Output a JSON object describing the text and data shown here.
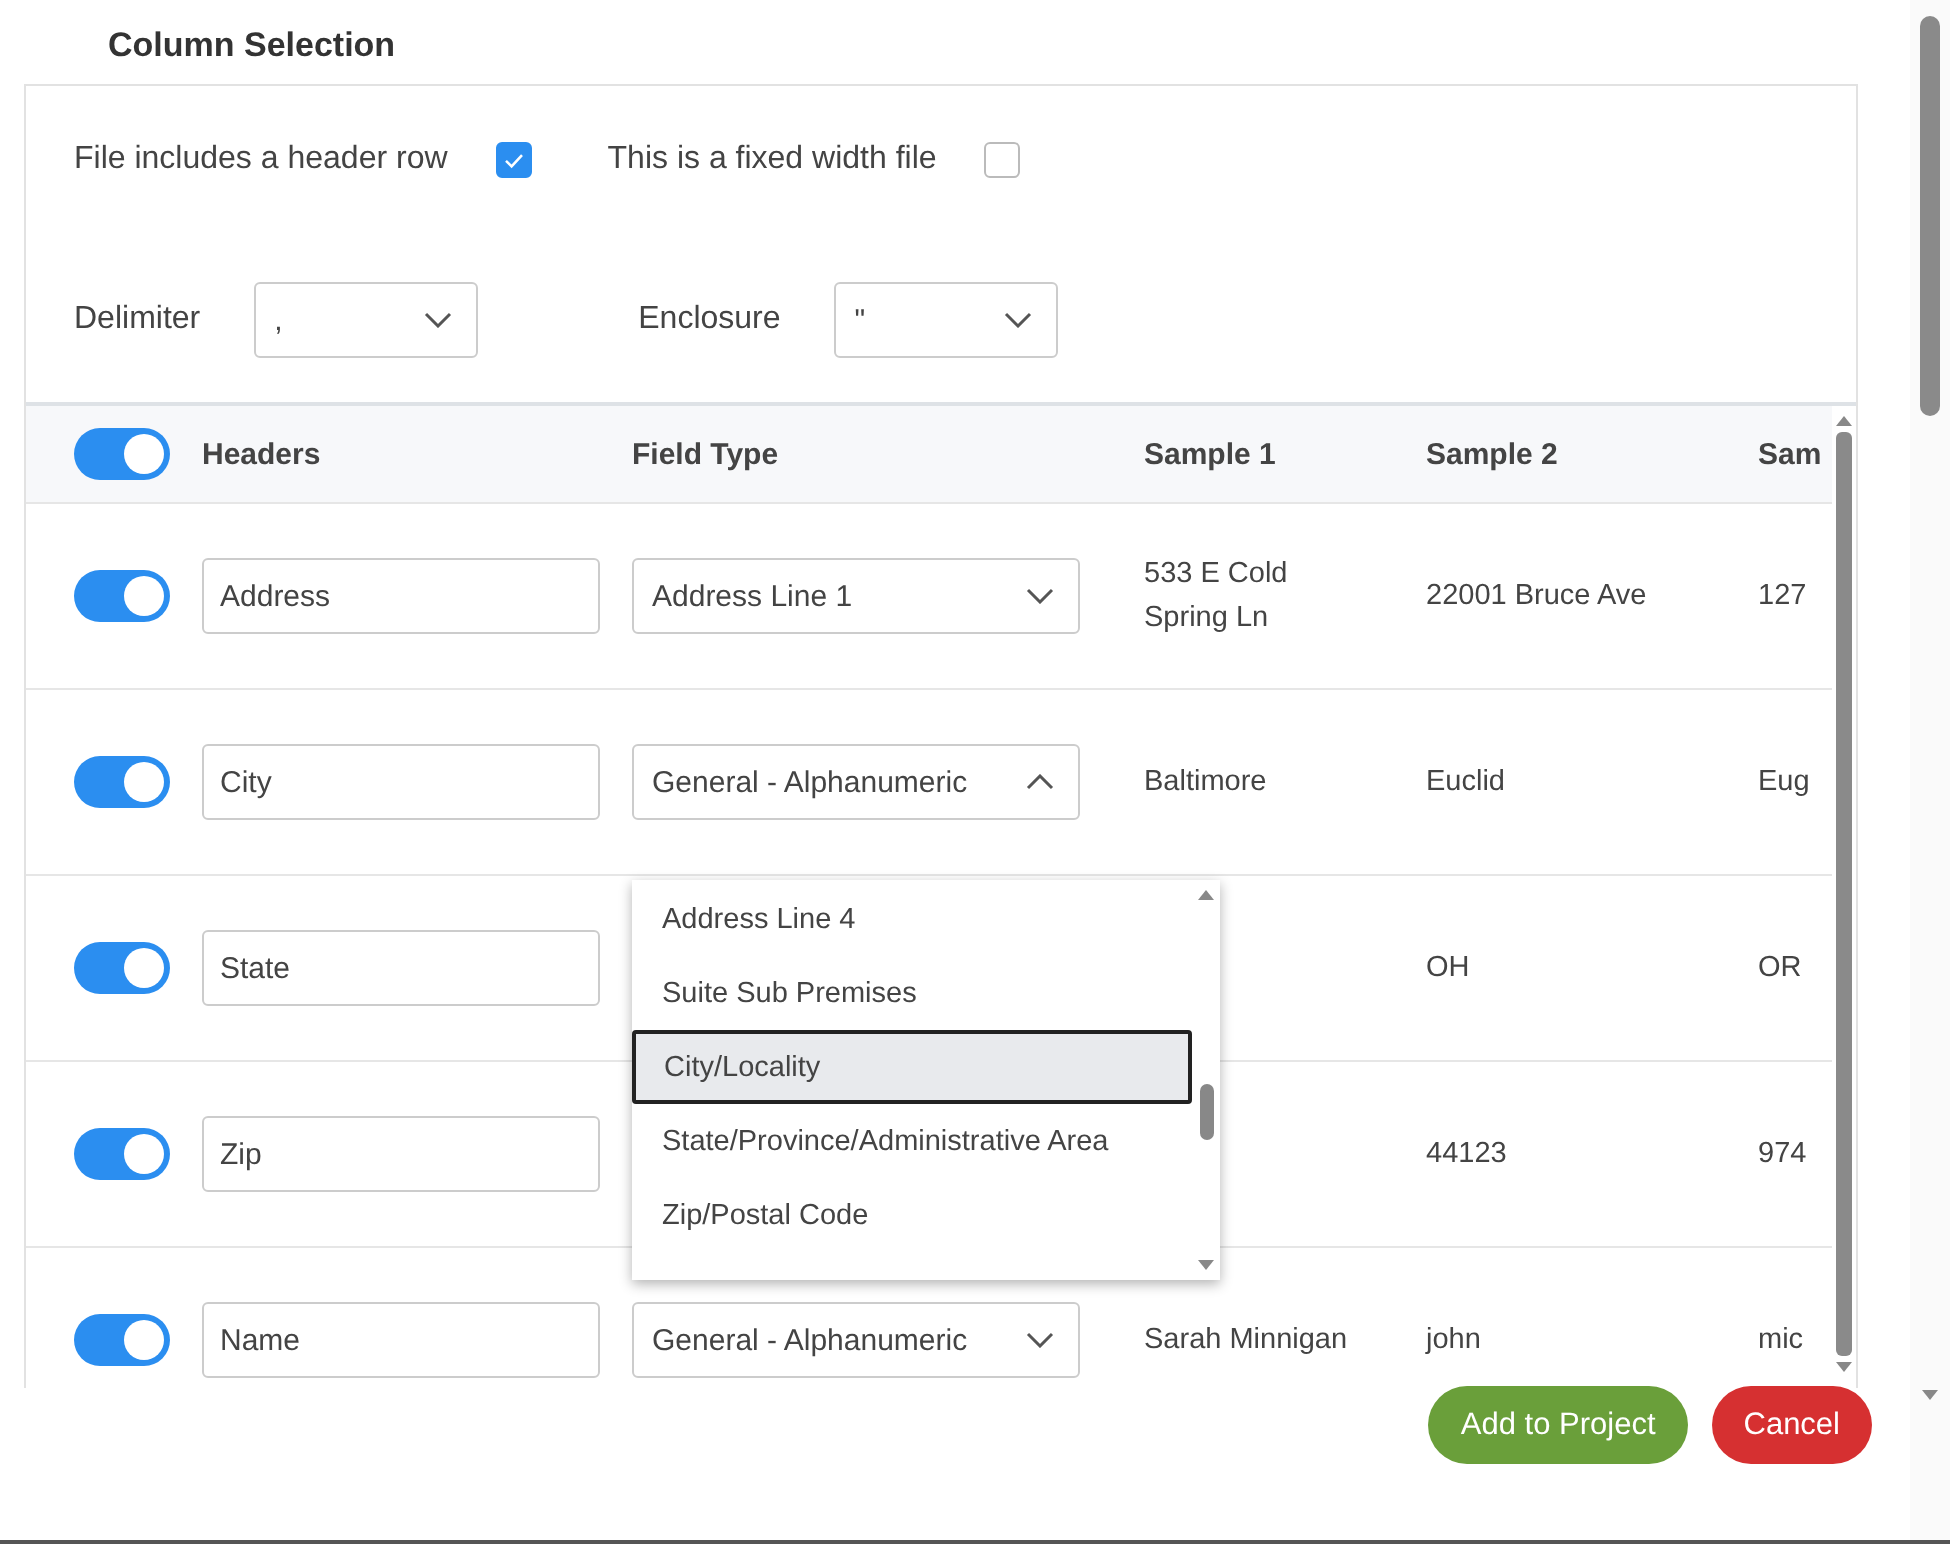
{
  "title": "Column Selection",
  "options": {
    "header_row": {
      "label": "File includes a header row",
      "checked": true
    },
    "fixed_width": {
      "label": "This is a fixed width file",
      "checked": false
    },
    "delimiter": {
      "label": "Delimiter",
      "value": ","
    },
    "enclosure": {
      "label": "Enclosure",
      "value": "\""
    }
  },
  "table": {
    "all_on": true,
    "columns": [
      "Headers",
      "Field Type",
      "Sample 1",
      "Sample 2",
      "Sam"
    ],
    "rows": [
      {
        "on": true,
        "header": "Address",
        "field_type": "Address Line 1",
        "expanded": false,
        "sample_1": "533 E Cold Spring Ln",
        "sample_2": "22001 Bruce Ave",
        "sample_3": "127"
      },
      {
        "on": true,
        "header": "City",
        "field_type": "General - Alphanumeric",
        "expanded": true,
        "sample_1": "Baltimore",
        "sample_2": "Euclid",
        "sample_3": "Eug"
      },
      {
        "on": true,
        "header": "State",
        "sample_2": "OH",
        "sample_3": "OR"
      },
      {
        "on": true,
        "header": "Zip",
        "sample_2": "44123",
        "sample_3": "974"
      },
      {
        "on": true,
        "header": "Name",
        "field_type": "General - Alphanumeric",
        "expanded": false,
        "sample_1": "Sarah Minnigan",
        "sample_2": "john",
        "sample_3": "mic"
      }
    ]
  },
  "dropdown": {
    "items": [
      {
        "label": "Address Line 4",
        "selected": false
      },
      {
        "label": "Suite Sub Premises",
        "selected": false
      },
      {
        "label": "City/Locality",
        "selected": true
      },
      {
        "label": "State/Province/Administrative Area",
        "selected": false
      },
      {
        "label": "Zip/Postal Code",
        "selected": false
      }
    ]
  },
  "buttons": [
    {
      "label": "Add to Project",
      "kind": "primary"
    },
    {
      "label": "Cancel",
      "kind": "danger"
    }
  ]
}
